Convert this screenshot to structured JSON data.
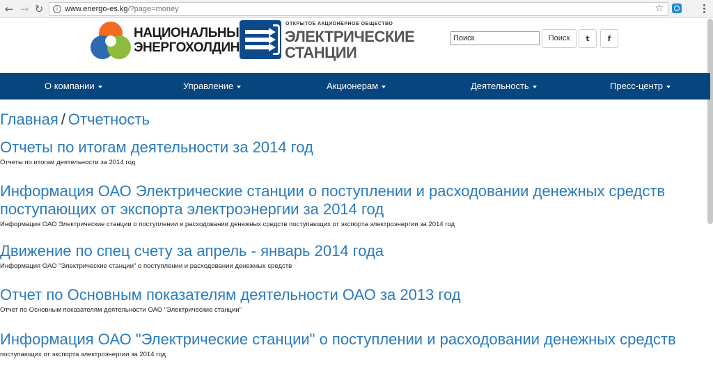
{
  "browser": {
    "url_host": "www.energo-es.kg",
    "url_path": "/?page=money",
    "icons": [
      "back-arrow-icon",
      "forward-arrow-icon",
      "reload-icon",
      "info-icon",
      "star-icon",
      "extension-icon",
      "menu-dots-icon"
    ]
  },
  "header": {
    "logo1_text_line1": "НАЦИОНАЛЬНЫЙ",
    "logo1_text_line2": "ЭНЕРГОХОЛДИНГ",
    "logo2_small": "ОТКРЫТОЕ АКЦИОНЕРНОЕ ОБЩЕСТВО",
    "logo2_text_line1": "ЭЛЕКТРИЧЕСКИЕ",
    "logo2_text_line2": "СТАНЦИИ",
    "search_value": "Поиск",
    "search_button": "Поиск",
    "twitter_label": "t",
    "facebook_label": "f"
  },
  "nav": {
    "items": [
      {
        "label": "О компании"
      },
      {
        "label": "Управление"
      },
      {
        "label": "Акционерам"
      },
      {
        "label": "Деятельность"
      },
      {
        "label": "Пресс-центр"
      }
    ],
    "color": "#07457e"
  },
  "breadcrumb": {
    "home": "Главная",
    "separator": "/",
    "current": "Отчетность"
  },
  "articles": [
    {
      "title": "Отчеты по итогам деятельности за 2014 год",
      "desc": "Отчеты по итогам деятельности за 2014 год"
    },
    {
      "title": "Информация ОАО Электрические станции о поступлении и расходовании денежных средств поступающих от экспорта электроэнергии за 2014 год",
      "desc": "Информация ОАО Электрические станции о поступлении и расходовании денежных средств поступающих от экспорта электроэнергии за 2014 год"
    },
    {
      "title": "Движение по спец счету за апрель - январь 2014 года",
      "desc": "Информация ОАО \"Электрические станции\" о поступлении и расходовании денежных средств"
    },
    {
      "title": "Отчет по Основным показателям деятельности ОАО за 2013 год",
      "desc": "Отчет по Основным показателям деятельности ОАО \"Электрические станции\""
    },
    {
      "title": "Информация ОАО \"Электрические станции\" о поступлении и расходовании денежных средств",
      "desc": "поступающих от экспорта электроэнергии за 2014 год"
    }
  ],
  "colors": {
    "link": "#2b7bbd",
    "navbar": "#07457e"
  }
}
